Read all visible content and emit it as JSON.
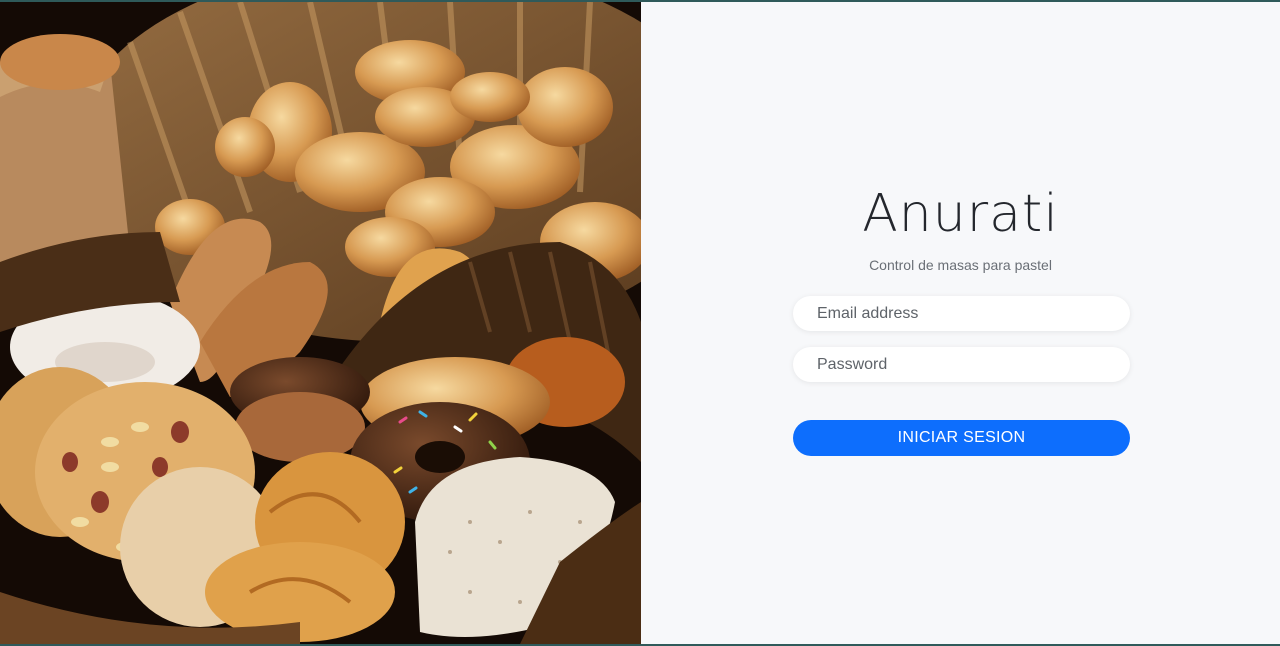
{
  "login": {
    "brand": "Anurati",
    "tagline": "Control de masas para pastel",
    "email_placeholder": "Email address",
    "password_placeholder": "Password",
    "submit_label": "INICIAR SESION"
  },
  "colors": {
    "accent": "#0d6efd",
    "panel_bg": "#f7f8fa",
    "frame": "#2f5a5a"
  },
  "hero_image": {
    "subject": "basket of assorted breads and pastries"
  }
}
